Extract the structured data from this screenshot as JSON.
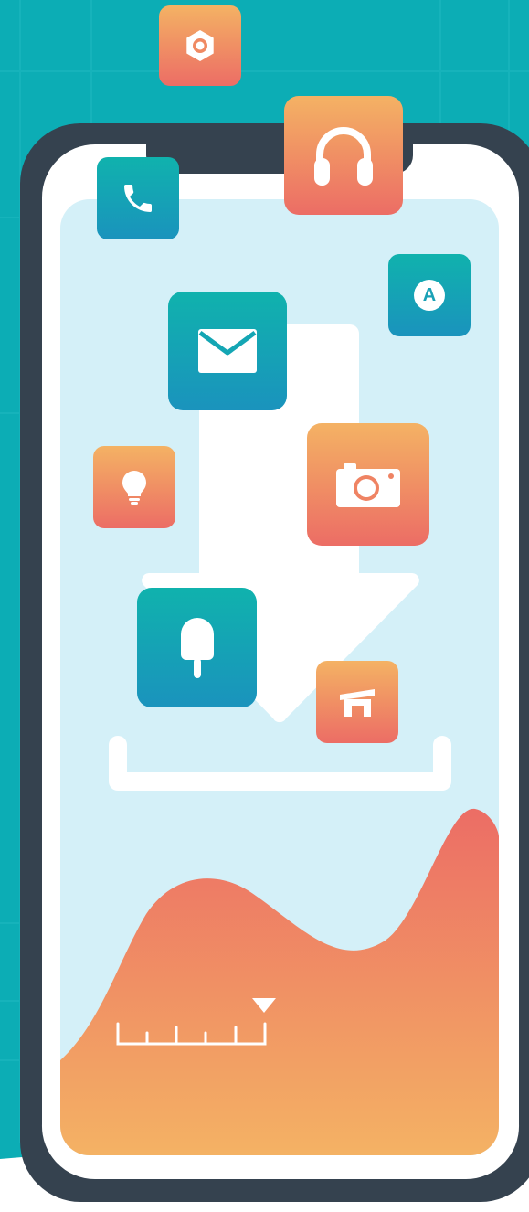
{
  "colors": {
    "background_teal": "#0cadb5",
    "phone_frame": "#35424f",
    "screen_light": "#d4f0f8",
    "teal_top": "#10b2ad",
    "teal_bottom": "#1a93bd",
    "orange_top": "#f4b264",
    "orange_bottom": "#ec6d65"
  },
  "floating_icons": [
    {
      "name": "settings",
      "icon": "gear-icon",
      "color": "orange"
    },
    {
      "name": "headphones",
      "icon": "headphones-icon",
      "color": "orange"
    },
    {
      "name": "phone",
      "icon": "phone-icon",
      "color": "teal"
    },
    {
      "name": "app-store",
      "icon": "letter-a-icon",
      "color": "teal",
      "letter": "A"
    },
    {
      "name": "mail",
      "icon": "envelope-icon",
      "color": "teal"
    },
    {
      "name": "ideas",
      "icon": "lightbulb-icon",
      "color": "orange"
    },
    {
      "name": "camera",
      "icon": "camera-icon",
      "color": "orange"
    },
    {
      "name": "dessert",
      "icon": "popsicle-icon",
      "color": "teal"
    },
    {
      "name": "home",
      "icon": "house-icon",
      "color": "orange"
    }
  ],
  "illustration": {
    "central_graphic": "download-arrow-into-tray",
    "bottom_graphic": "wave-area-with-ruler-and-marker"
  }
}
